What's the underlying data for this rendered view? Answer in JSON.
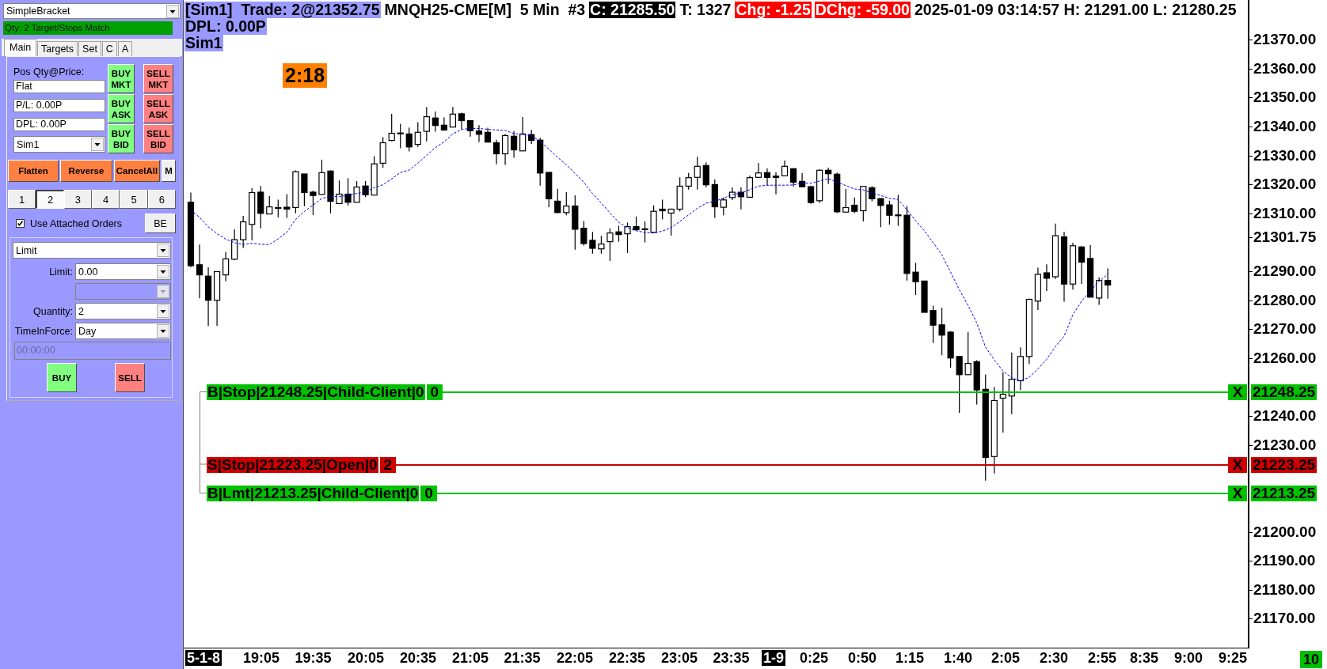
{
  "order_panel": {
    "strategy": {
      "value": "SimpleBracket"
    },
    "status": "Qty: 2 Target/Stops Match",
    "tabs": [
      {
        "label": "Main",
        "selected": true
      },
      {
        "label": "Targets",
        "selected": false
      },
      {
        "label": "Set",
        "selected": false
      },
      {
        "label": "C",
        "selected": false
      },
      {
        "label": "A",
        "selected": false
      }
    ],
    "position_label": "Pos Qty@Price:",
    "readouts": [
      {
        "value": "Flat"
      },
      {
        "value": "P/L: 0.00P"
      },
      {
        "value": "DPL: 0.00P"
      }
    ],
    "account": {
      "value": "Sim1"
    },
    "trade_buttons": [
      {
        "label": "BUY MKT",
        "kind": "buy"
      },
      {
        "label": "SELL MKT",
        "kind": "sell"
      },
      {
        "label": "BUY ASK",
        "kind": "buy"
      },
      {
        "label": "SELL ASK",
        "kind": "sell"
      },
      {
        "label": "BUY BID",
        "kind": "buy"
      },
      {
        "label": "SELL BID",
        "kind": "sell"
      }
    ],
    "action_buttons": [
      {
        "label": "Flatten",
        "kind": "action"
      },
      {
        "label": "Reverse",
        "kind": "action"
      },
      {
        "label": "CancelAll",
        "kind": "action"
      },
      {
        "label": "M",
        "kind": "toggle"
      }
    ],
    "quantity_presets": [
      {
        "label": "1",
        "selected": false
      },
      {
        "label": "2",
        "selected": true
      },
      {
        "label": "3",
        "selected": false
      },
      {
        "label": "4",
        "selected": false
      },
      {
        "label": "5",
        "selected": false
      },
      {
        "label": "6",
        "selected": false
      }
    ],
    "attached_orders": {
      "label": "Use Attached Orders",
      "checked": true
    },
    "be_button": "BE",
    "order_type": {
      "value": "Limit"
    },
    "order_fields": [
      {
        "label": "Limit:",
        "value": "0.00",
        "disabled": false
      },
      {
        "disabled": true
      },
      {
        "label": "Quantity:",
        "value": "2",
        "disabled": false
      },
      {
        "label": "TimeInForce:",
        "value": "Day",
        "disabled": false
      }
    ],
    "time_field": {
      "value": "00:00:00",
      "disabled": true
    },
    "submit_buttons": [
      {
        "label": "BUY",
        "kind": "buy"
      },
      {
        "label": "SELL",
        "kind": "sell"
      }
    ]
  },
  "chart": {
    "header_lines": [
      {
        "segments": [
          {
            "text": "[Sim1]  Trade: 2@21352.75",
            "kind": "account"
          },
          {
            "text": "MNQH25-CME[M]  5 Min  #3",
            "kind": "plain"
          },
          {
            "text": "C: 21285.50",
            "kind": "inverse"
          },
          {
            "text": "T: 1327",
            "kind": "plain"
          },
          {
            "text": "Chg: -1.25",
            "kind": "alert"
          },
          {
            "text": "DChg: -59.00",
            "kind": "alert"
          },
          {
            "text": "2025-01-09 03:14:57 H: 21291.00 L: 21280.25",
            "kind": "plain"
          }
        ]
      },
      {
        "segments": [
          {
            "text": "DPL: 0.00P",
            "kind": "account"
          }
        ]
      },
      {
        "segments": [
          {
            "text": "Sim1",
            "kind": "account"
          }
        ]
      }
    ],
    "bar_timer": "2:18",
    "orders": [
      {
        "label": "B|Stop|21248.25|Child-Client|0",
        "quantity": "0",
        "close_button": "X",
        "price": "21248.25",
        "color": "#00c000"
      },
      {
        "label": "S|Stop|21223.25|Open|0",
        "quantity": "2",
        "close_button": "X",
        "price": "21223.25",
        "color": "#cc0000"
      },
      {
        "label": "B|Lmt|21213.25|Child-Client|0",
        "quantity": "0",
        "close_button": "X",
        "price": "21213.25",
        "color": "#00c000"
      }
    ],
    "price_axis": [
      "21370.00",
      "21360.00",
      "21350.00",
      "21340.00",
      "21330.00",
      "21320.00",
      "21310.00",
      "21301.75",
      "21290.00",
      "21280.00",
      "21270.00",
      "21260.00",
      "21240.00",
      "21230.00",
      "21200.00",
      "21190.00",
      "21180.00",
      "21170.00"
    ],
    "time_axis": [
      {
        "text": "5-1-8",
        "kind": "date"
      },
      {
        "text": "19:05",
        "kind": "time"
      },
      {
        "text": "19:35",
        "kind": "time"
      },
      {
        "text": "20:05",
        "kind": "time"
      },
      {
        "text": "20:35",
        "kind": "time"
      },
      {
        "text": "21:05",
        "kind": "time"
      },
      {
        "text": "21:35",
        "kind": "time"
      },
      {
        "text": "22:05",
        "kind": "time"
      },
      {
        "text": "22:35",
        "kind": "time"
      },
      {
        "text": "23:05",
        "kind": "time"
      },
      {
        "text": "23:35",
        "kind": "time"
      },
      {
        "text": "1-9",
        "kind": "date"
      },
      {
        "text": "0:25",
        "kind": "time"
      },
      {
        "text": "0:50",
        "kind": "time"
      },
      {
        "text": "1:15",
        "kind": "time"
      },
      {
        "text": "1:40",
        "kind": "time"
      },
      {
        "text": "2:05",
        "kind": "time"
      },
      {
        "text": "2:30",
        "kind": "time"
      },
      {
        "text": "2:55",
        "kind": "time"
      },
      {
        "text": "8:35",
        "kind": "time"
      },
      {
        "text": "9:00",
        "kind": "time"
      },
      {
        "text": "9:25",
        "kind": "time"
      }
    ],
    "bar_counter": "10"
  }
}
